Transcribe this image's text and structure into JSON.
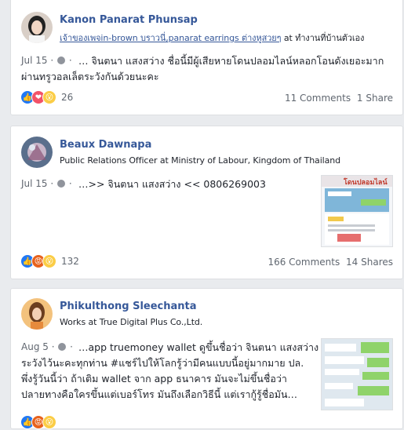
{
  "posts": [
    {
      "author": "Kanon Panarat Phunsap",
      "subline_link": "เจ้าของเพจin-brown บราวนี่,panarat earrings ต่างหูสวยๆ",
      "subline_rest": "at ทำงานที่บ้านตัวเอง",
      "date": "Jul 15",
      "text_line1": "… จินตนา แสงสว่าง ชื่อนี้มีผู้เสียหายโดนปลอมไลน์หลอกโอนดังเยอะมาก",
      "text_line2": "ผ่านทรูวอลเล็ตระวังกันด้วยนะคะ",
      "reactions": [
        "like",
        "love",
        "wow"
      ],
      "reaction_count": "26",
      "comments": "11 Comments",
      "shares": "1 Share"
    },
    {
      "author": "Beaux Dawnapa",
      "subline": "Public Relations Officer at Ministry of Labour, Kingdom of Thailand",
      "date": "Jul 15",
      "text_line1": "…>> จินตนา แสงสว่าง << 0806269003",
      "thumb_text": "โดนปลอมไลน์",
      "reactions": [
        "like",
        "angry",
        "wow"
      ],
      "reaction_count": "132",
      "comments": "166 Comments",
      "shares": "14 Shares"
    },
    {
      "author": "Phikulthong Sleechanta",
      "subline": "Works at True Digital Plus Co.,Ltd.",
      "date": "Aug 5",
      "text_line1": "…app truemoney wallet ดูขึ้นชื่อว่า จินตนา แสงสว่าง",
      "text_line2": "ระวังไว้นะคะทุกท่าน #แชร์ไปให้โลกรู้ว่ามีคนแบบนี้อยู่มากมาย ปล.",
      "text_line3": "พึ่งรู้วันนี้ว่า ถ้าเติม wallet จาก app ธนาคาร มันจะไม่ขึ้นชื่อว่า",
      "text_line4": "ปลายทางคือใครขึ้นแต่เบอร์โทร มันถึงเลือกวิธีนี้ แต่เรากู้รู้ชื่อมัน…"
    }
  ],
  "colors": {
    "link": "#365899",
    "meta": "#616770",
    "background": "#e9ebee"
  }
}
